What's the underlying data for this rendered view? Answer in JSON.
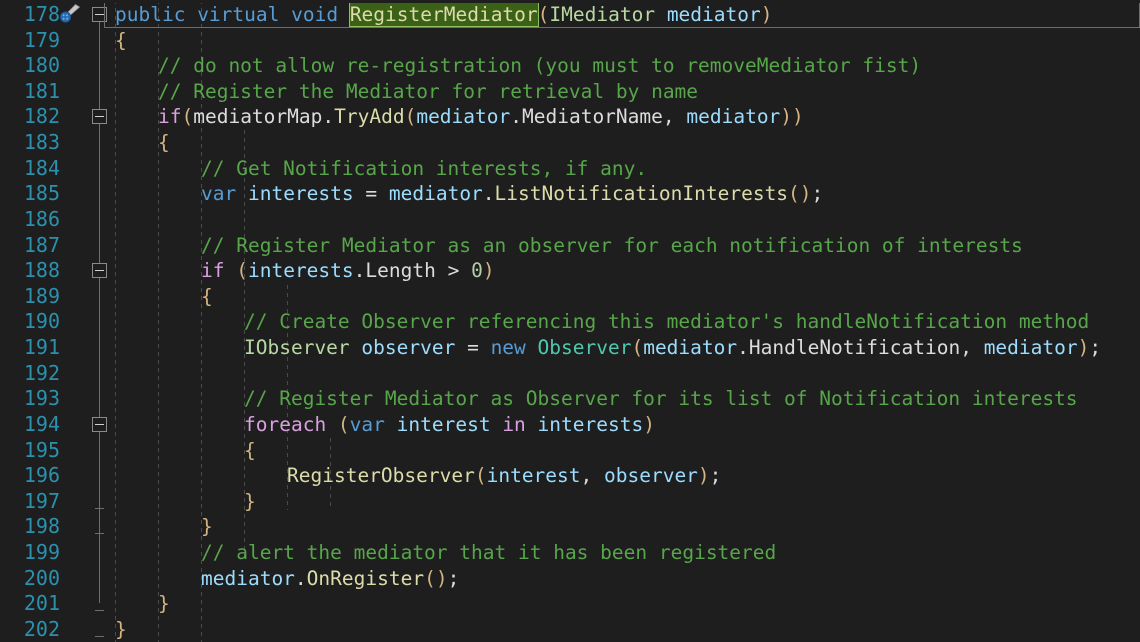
{
  "editor": {
    "theme_name": "dark",
    "language": "csharp",
    "background_color": "#1e1e1e",
    "line_number_color": "#2b91af",
    "current_line": 178,
    "first_visible_line": 178,
    "last_visible_line": 202,
    "selection": {
      "text": "RegisterMediator",
      "line": 178,
      "background_color": "#3b6117",
      "border_color": "#8fbf5f"
    },
    "gutter_icon": {
      "name": "quick-actions-screwdriver-icon",
      "line": 178,
      "color": "#3f7fc1"
    }
  },
  "palette": {
    "keyword": "#569cd6",
    "control_keyword": "#d8a0df",
    "class_type": "#4ec9b0",
    "interface_type": "#b8d7a3",
    "method": "#dcdcaa",
    "parameter": "#9cdcfe",
    "local": "#9cdcfe",
    "plain": "#dcdcdc",
    "comment": "#57a64a",
    "number": "#b5cea8",
    "brace": "#d4b483",
    "indent_guide": "#4b4b4b",
    "fold_line": "#6e6e6e"
  },
  "line_numbers": [
    "178",
    "179",
    "180",
    "181",
    "182",
    "183",
    "184",
    "185",
    "186",
    "187",
    "188",
    "189",
    "190",
    "191",
    "192",
    "193",
    "194",
    "195",
    "196",
    "197",
    "198",
    "199",
    "200",
    "201",
    "202"
  ],
  "folding": {
    "collapse_boxes_on_lines": [
      178,
      182,
      188,
      194
    ],
    "end_tick_lines": [
      197,
      198,
      201,
      202
    ]
  },
  "code": {
    "lines": [
      {
        "number": "178",
        "indent": 0,
        "text": "public virtual void RegisterMediator(IMediator mediator)"
      },
      {
        "number": "179",
        "indent": 0,
        "text": "{"
      },
      {
        "number": "180",
        "indent": 1,
        "text": "// do not allow re-registration (you must to removeMediator fist)"
      },
      {
        "number": "181",
        "indent": 1,
        "text": "// Register the Mediator for retrieval by name"
      },
      {
        "number": "182",
        "indent": 1,
        "text": "if(mediatorMap.TryAdd(mediator.MediatorName, mediator))"
      },
      {
        "number": "183",
        "indent": 1,
        "text": "{"
      },
      {
        "number": "184",
        "indent": 2,
        "text": "// Get Notification interests, if any."
      },
      {
        "number": "185",
        "indent": 2,
        "text": "var interests = mediator.ListNotificationInterests();"
      },
      {
        "number": "186",
        "indent": 2,
        "text": ""
      },
      {
        "number": "187",
        "indent": 2,
        "text": "// Register Mediator as an observer for each notification of interests"
      },
      {
        "number": "188",
        "indent": 2,
        "text": "if (interests.Length > 0)"
      },
      {
        "number": "189",
        "indent": 2,
        "text": "{"
      },
      {
        "number": "190",
        "indent": 3,
        "text": "// Create Observer referencing this mediator's handleNotification method"
      },
      {
        "number": "191",
        "indent": 3,
        "text": "IObserver observer = new Observer(mediator.HandleNotification, mediator);"
      },
      {
        "number": "192",
        "indent": 3,
        "text": ""
      },
      {
        "number": "193",
        "indent": 3,
        "text": "// Register Mediator as Observer for its list of Notification interests"
      },
      {
        "number": "194",
        "indent": 3,
        "text": "foreach (var interest in interests)"
      },
      {
        "number": "195",
        "indent": 3,
        "text": "{"
      },
      {
        "number": "196",
        "indent": 4,
        "text": "RegisterObserver(interest, observer);"
      },
      {
        "number": "197",
        "indent": 3,
        "text": "}"
      },
      {
        "number": "198",
        "indent": 2,
        "text": "}"
      },
      {
        "number": "199",
        "indent": 2,
        "text": "// alert the mediator that it has been registered"
      },
      {
        "number": "200",
        "indent": 2,
        "text": "mediator.OnRegister();"
      },
      {
        "number": "201",
        "indent": 1,
        "text": "}"
      },
      {
        "number": "202",
        "indent": 0,
        "text": "}"
      }
    ],
    "tokens": [
      {
        "line": "178",
        "parts": [
          {
            "t": "public ",
            "c": "t-kw"
          },
          {
            "t": "virtual ",
            "c": "t-kw"
          },
          {
            "t": "void ",
            "c": "t-kw"
          },
          {
            "t": "RegisterMediator",
            "c": "t-sel"
          },
          {
            "t": "(",
            "c": "t-paren"
          },
          {
            "t": "IMediator ",
            "c": "t-iface"
          },
          {
            "t": "mediator",
            "c": "t-param"
          },
          {
            "t": ")",
            "c": "t-paren"
          }
        ]
      },
      {
        "line": "179",
        "parts": [
          {
            "t": "{",
            "c": "t-brace"
          }
        ]
      },
      {
        "line": "180",
        "parts": [
          {
            "t": "// do not allow re-registration (you must to removeMediator fist)",
            "c": "t-comment"
          }
        ]
      },
      {
        "line": "181",
        "parts": [
          {
            "t": "// Register the Mediator for retrieval by name",
            "c": "t-comment"
          }
        ]
      },
      {
        "line": "182",
        "parts": [
          {
            "t": "if",
            "c": "t-ctrl"
          },
          {
            "t": "(",
            "c": "t-paren"
          },
          {
            "t": "mediatorMap",
            "c": "t-plain"
          },
          {
            "t": ".",
            "c": "t-plain"
          },
          {
            "t": "TryAdd",
            "c": "t-method"
          },
          {
            "t": "(",
            "c": "t-paren"
          },
          {
            "t": "mediator",
            "c": "t-param"
          },
          {
            "t": ".",
            "c": "t-plain"
          },
          {
            "t": "MediatorName",
            "c": "t-plain"
          },
          {
            "t": ", ",
            "c": "t-plain"
          },
          {
            "t": "mediator",
            "c": "t-param"
          },
          {
            "t": "))",
            "c": "t-paren"
          }
        ]
      },
      {
        "line": "183",
        "parts": [
          {
            "t": "{",
            "c": "t-brace"
          }
        ]
      },
      {
        "line": "184",
        "parts": [
          {
            "t": "// Get Notification interests, if any.",
            "c": "t-comment"
          }
        ]
      },
      {
        "line": "185",
        "parts": [
          {
            "t": "var ",
            "c": "t-kw"
          },
          {
            "t": "interests",
            "c": "t-local"
          },
          {
            "t": " = ",
            "c": "t-plain"
          },
          {
            "t": "mediator",
            "c": "t-param"
          },
          {
            "t": ".",
            "c": "t-plain"
          },
          {
            "t": "ListNotificationInterests",
            "c": "t-method"
          },
          {
            "t": "()",
            "c": "t-paren"
          },
          {
            "t": ";",
            "c": "t-plain"
          }
        ]
      },
      {
        "line": "186",
        "parts": []
      },
      {
        "line": "187",
        "parts": [
          {
            "t": "// Register Mediator as an observer for each notification of interests",
            "c": "t-comment"
          }
        ]
      },
      {
        "line": "188",
        "parts": [
          {
            "t": "if ",
            "c": "t-ctrl"
          },
          {
            "t": "(",
            "c": "t-paren"
          },
          {
            "t": "interests",
            "c": "t-local"
          },
          {
            "t": ".",
            "c": "t-plain"
          },
          {
            "t": "Length",
            "c": "t-plain"
          },
          {
            "t": " > ",
            "c": "t-plain"
          },
          {
            "t": "0",
            "c": "t-num"
          },
          {
            "t": ")",
            "c": "t-paren"
          }
        ]
      },
      {
        "line": "189",
        "parts": [
          {
            "t": "{",
            "c": "t-brace"
          }
        ]
      },
      {
        "line": "190",
        "parts": [
          {
            "t": "// Create Observer referencing this mediator's handleNotification method",
            "c": "t-comment"
          }
        ]
      },
      {
        "line": "191",
        "parts": [
          {
            "t": "IObserver ",
            "c": "t-iface"
          },
          {
            "t": "observer",
            "c": "t-local"
          },
          {
            "t": " = ",
            "c": "t-plain"
          },
          {
            "t": "new ",
            "c": "t-kw"
          },
          {
            "t": "Observer",
            "c": "t-type"
          },
          {
            "t": "(",
            "c": "t-paren"
          },
          {
            "t": "mediator",
            "c": "t-param"
          },
          {
            "t": ".",
            "c": "t-plain"
          },
          {
            "t": "HandleNotification",
            "c": "t-plain"
          },
          {
            "t": ", ",
            "c": "t-plain"
          },
          {
            "t": "mediator",
            "c": "t-param"
          },
          {
            "t": ")",
            "c": "t-paren"
          },
          {
            "t": ";",
            "c": "t-plain"
          }
        ]
      },
      {
        "line": "192",
        "parts": []
      },
      {
        "line": "193",
        "parts": [
          {
            "t": "// Register Mediator as Observer for its list of Notification interests",
            "c": "t-comment"
          }
        ]
      },
      {
        "line": "194",
        "parts": [
          {
            "t": "foreach ",
            "c": "t-ctrl"
          },
          {
            "t": "(",
            "c": "t-paren"
          },
          {
            "t": "var ",
            "c": "t-kw"
          },
          {
            "t": "interest",
            "c": "t-local"
          },
          {
            "t": " ",
            "c": "t-plain"
          },
          {
            "t": "in",
            "c": "t-ctrl"
          },
          {
            "t": " ",
            "c": "t-plain"
          },
          {
            "t": "interests",
            "c": "t-local"
          },
          {
            "t": ")",
            "c": "t-paren"
          }
        ]
      },
      {
        "line": "195",
        "parts": [
          {
            "t": "{",
            "c": "t-brace"
          }
        ]
      },
      {
        "line": "196",
        "parts": [
          {
            "t": "RegisterObserver",
            "c": "t-method"
          },
          {
            "t": "(",
            "c": "t-paren"
          },
          {
            "t": "interest",
            "c": "t-local"
          },
          {
            "t": ", ",
            "c": "t-plain"
          },
          {
            "t": "observer",
            "c": "t-local"
          },
          {
            "t": ")",
            "c": "t-paren"
          },
          {
            "t": ";",
            "c": "t-plain"
          }
        ]
      },
      {
        "line": "197",
        "parts": [
          {
            "t": "}",
            "c": "t-brace"
          }
        ]
      },
      {
        "line": "198",
        "parts": [
          {
            "t": "}",
            "c": "t-brace"
          }
        ]
      },
      {
        "line": "199",
        "parts": [
          {
            "t": "// alert the mediator that it has been registered",
            "c": "t-comment"
          }
        ]
      },
      {
        "line": "200",
        "parts": [
          {
            "t": "mediator",
            "c": "t-param"
          },
          {
            "t": ".",
            "c": "t-plain"
          },
          {
            "t": "OnRegister",
            "c": "t-method"
          },
          {
            "t": "()",
            "c": "t-paren"
          },
          {
            "t": ";",
            "c": "t-plain"
          }
        ]
      },
      {
        "line": "201",
        "parts": [
          {
            "t": "}",
            "c": "t-brace"
          }
        ]
      },
      {
        "line": "202",
        "parts": [
          {
            "t": "}",
            "c": "t-brace"
          }
        ]
      }
    ]
  }
}
